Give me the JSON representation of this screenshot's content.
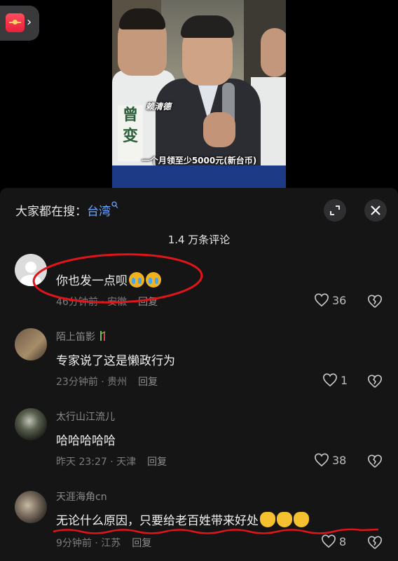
{
  "video": {
    "speaker_name": "赖清德",
    "caption": "一个月领至少5000元(新台币)",
    "sign_text": "曾\n变"
  },
  "redpacket": {
    "chevron": "›"
  },
  "panel": {
    "search_prefix": "大家都在搜：",
    "search_term": "台湾",
    "comment_count_title": "1.4 万条评论"
  },
  "comments": [
    {
      "user": "",
      "text": "你也发一点呗",
      "time_location": "46分钟前 · 安徽",
      "reply": "回复",
      "likes": "36"
    },
    {
      "user": "陌上笛影",
      "text": "专家说了这是懒政行为",
      "time_location": "23分钟前 · 贵州",
      "reply": "回复",
      "likes": "1"
    },
    {
      "user": "太行山江流儿",
      "text": "哈哈哈哈哈",
      "time_location": "昨天 23:27 · 天津",
      "reply": "回复",
      "likes": "38"
    },
    {
      "user": "天涯海角cn",
      "text": "无论什么原因，只要给老百姓带来好处",
      "time_location": "9分钟前 · 江苏",
      "reply": "回复",
      "likes": "8"
    }
  ],
  "colors": {
    "accent_link": "#6aa6ff",
    "annotation_red": "#e0151a",
    "panel_bg": "#151516"
  },
  "icons": [
    "redpacket-icon",
    "search-icon",
    "expand-icon",
    "close-icon",
    "heart-icon",
    "broken-heart-icon",
    "crying-face-emoji",
    "clapping-hands-emoji",
    "bamboo-badge-icon"
  ]
}
